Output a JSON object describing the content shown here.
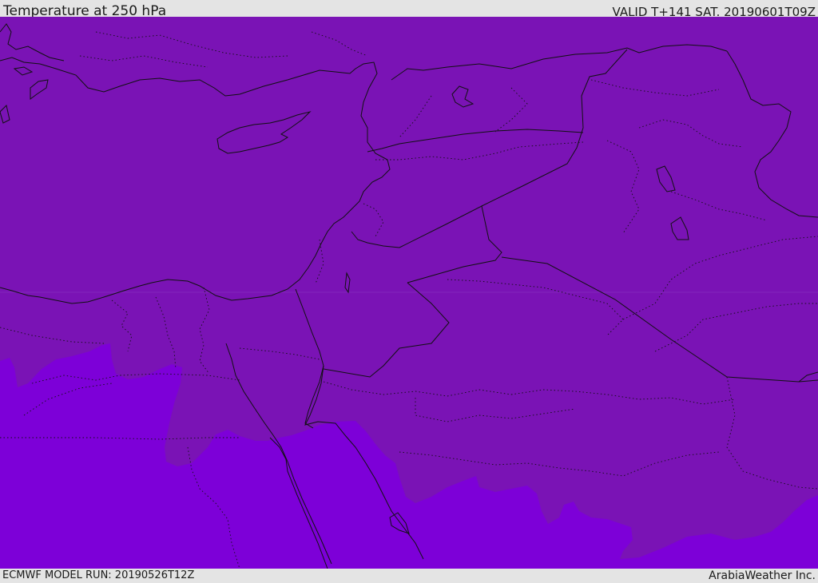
{
  "header": {
    "title": "Temperature at 250 hPa",
    "valid": "VALID T+141 SAT. 20190601T09Z"
  },
  "footer": {
    "model_run": "ECMWF MODEL RUN: 20190526T12Z",
    "credit": "ArabiaWeather Inc."
  },
  "colors": {
    "band_warm": "#7a13b5",
    "band_cold": "#7d00d8",
    "coast": "#111111",
    "bars": "#e4e4e4"
  }
}
